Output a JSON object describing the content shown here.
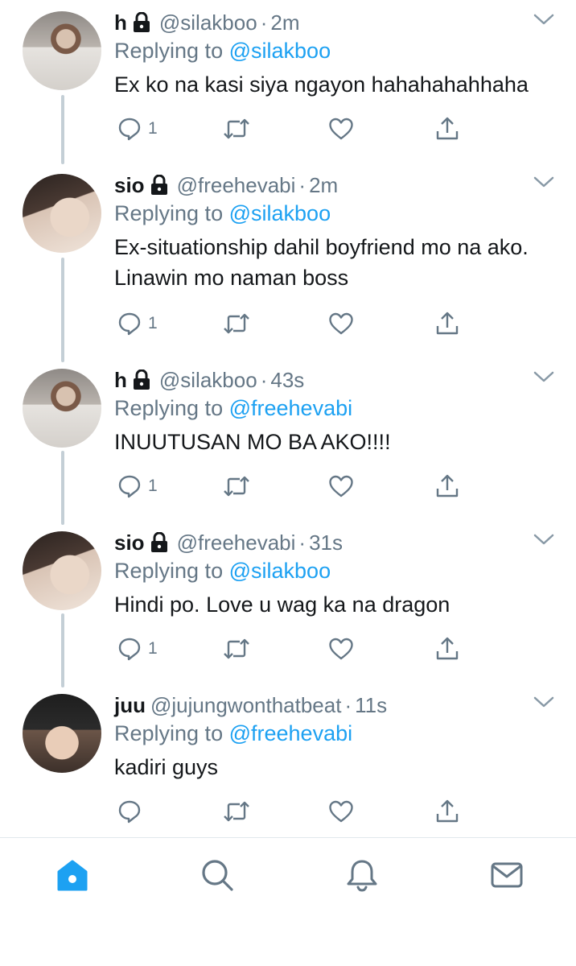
{
  "tweets": [
    {
      "name": "h",
      "handle": "@silakboo",
      "dot": "·",
      "time": "2m",
      "replying_label": "Replying to",
      "replying_to": "@silakboo",
      "text": "Ex ko na kasi siya ngayon hahahahahhaha",
      "reply_count": "1"
    },
    {
      "name": "sio",
      "handle": "@freehevabi",
      "dot": "·",
      "time": "2m",
      "replying_label": "Replying to",
      "replying_to": "@silakboo",
      "text": "Ex-situationship dahil boyfriend mo na ako. Linawin mo naman boss",
      "reply_count": "1"
    },
    {
      "name": "h",
      "handle": "@silakboo",
      "dot": "·",
      "time": "43s",
      "replying_label": "Replying to",
      "replying_to": "@freehevabi",
      "text": "INUUTUSAN MO BA AKO!!!!",
      "reply_count": "1"
    },
    {
      "name": "sio",
      "handle": "@freehevabi",
      "dot": "·",
      "time": "31s",
      "replying_label": "Replying to",
      "replying_to": "@silakboo",
      "text": "Hindi po. Love u wag ka na dragon",
      "reply_count": "1"
    },
    {
      "name": "juu",
      "handle": "@jujungwonthatbeat",
      "dot": "·",
      "time": "11s",
      "replying_label": "Replying to",
      "replying_to": "@freehevabi",
      "text": "kadiri guys",
      "reply_count": ""
    }
  ],
  "tabbar": {
    "items": [
      "home-icon",
      "search-icon",
      "notifications-icon",
      "messages-icon"
    ],
    "active": "home-icon"
  },
  "colors": {
    "accent": "#1da1f2",
    "secondary_text": "#657786",
    "thread_line": "#c4cfd6",
    "icon": "#657786"
  }
}
